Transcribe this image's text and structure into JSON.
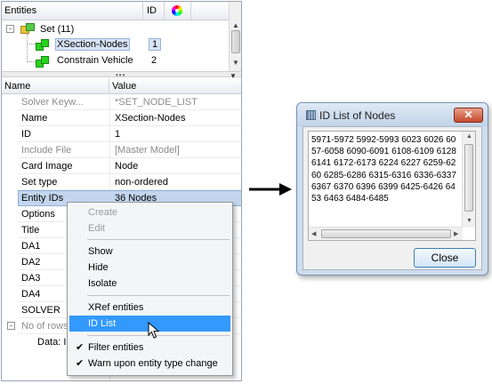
{
  "entity_tree": {
    "header": {
      "entities_label": "Entities",
      "id_label": "ID",
      "color_icon": "color-wheel-icon"
    },
    "rows": [
      {
        "label": "Set (11)",
        "id": "",
        "icon": "set-icon",
        "expander": "-"
      },
      {
        "label": "XSection-Nodes",
        "id": "1",
        "icon": "node-icon",
        "selected": true
      },
      {
        "label": "Constrain Vehicle",
        "id": "2",
        "icon": "node-icon"
      }
    ]
  },
  "properties": {
    "header": {
      "name_label": "Name",
      "value_label": "Value"
    },
    "rows": [
      {
        "name": "Solver Keyw...",
        "value": "*SET_NODE_LIST",
        "disabled": true
      },
      {
        "name": "Name",
        "value": "XSection-Nodes"
      },
      {
        "name": "ID",
        "value": "1"
      },
      {
        "name": "Include File",
        "value": "[Master Model]",
        "disabled": true
      },
      {
        "name": "Card Image",
        "value": "Node"
      },
      {
        "name": "Set type",
        "value": "non-ordered"
      },
      {
        "name": "Entity IDs",
        "value": "36 Nodes",
        "highlighted": true
      },
      {
        "name": "Options",
        "value": ""
      },
      {
        "name": "Title",
        "value": ""
      },
      {
        "name": "DA1",
        "value": ""
      },
      {
        "name": "DA2",
        "value": ""
      },
      {
        "name": "DA3",
        "value": ""
      },
      {
        "name": "DA4",
        "value": ""
      },
      {
        "name": "SOLVER",
        "value": ""
      },
      {
        "name": "No of rows",
        "value": "",
        "disabled": true,
        "expander": "-"
      },
      {
        "name": "Data: II",
        "value": ""
      }
    ]
  },
  "context_menu": {
    "items": [
      {
        "label": "Create",
        "disabled": true
      },
      {
        "label": "Edit",
        "disabled": true
      },
      {
        "label": "Show"
      },
      {
        "label": "Hide"
      },
      {
        "label": "Isolate"
      },
      {
        "label": "XRef entities"
      },
      {
        "label": "ID List",
        "active": true
      },
      {
        "label": "Filter entities",
        "checked": true
      },
      {
        "label": "Warn upon entity type change",
        "checked": true
      }
    ]
  },
  "dialog": {
    "title": "ID List of Nodes",
    "close_glyph": "✕",
    "id_list_text": "5971-5972 5992-5993 6023 6026 60\n57-6058 6090-6091 6108-6109 6128\n6141 6172-6173 6224 6227 6259-62\n60 6285-6286 6315-6316 6336-6337\n6367 6370 6396 6399 6425-6426 64\n53 6463 6484-6485",
    "close_button_label": "Close"
  },
  "colors": {
    "selection_blue": "#3399ff",
    "highlight_row": "#c3d6ee",
    "node_green": "#27d31b",
    "dialog_frame": "#cfdcec"
  }
}
